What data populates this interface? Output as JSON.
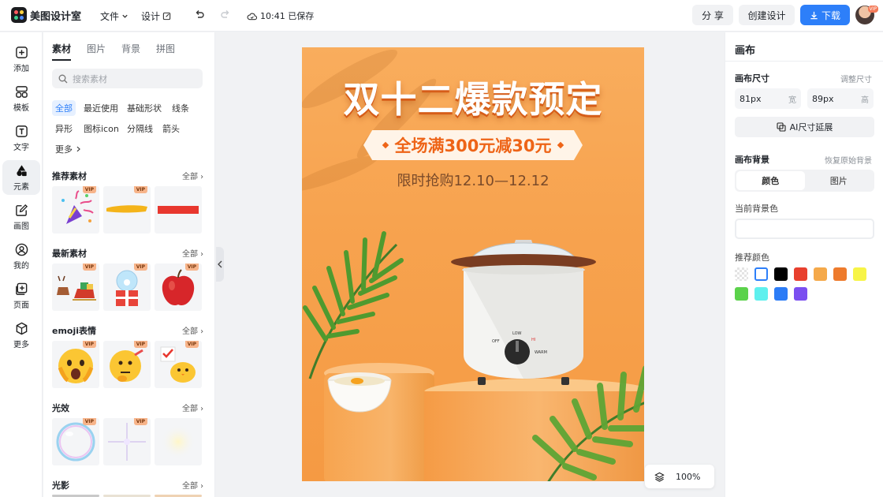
{
  "topbar": {
    "brand": "美图设计室",
    "file_menu": "文件",
    "design_menu": "设计",
    "saved_status": "10:41 已保存",
    "share_label": "分 享",
    "create_label": "创建设计",
    "download_label": "下载",
    "avatar_badge": "VIP"
  },
  "leftnav": {
    "items": [
      {
        "label": "添加",
        "icon": "plus-square-icon"
      },
      {
        "label": "模板",
        "icon": "template-grid-icon"
      },
      {
        "label": "文字",
        "icon": "text-t-icon"
      },
      {
        "label": "元素",
        "icon": "shapes-icon"
      },
      {
        "label": "画图",
        "icon": "edit-pencil-icon"
      },
      {
        "label": "我的",
        "icon": "user-icon"
      },
      {
        "label": "页面",
        "icon": "add-page-icon"
      },
      {
        "label": "更多",
        "icon": "cube-icon"
      }
    ],
    "active": "元素"
  },
  "panel": {
    "tabs": [
      "素材",
      "图片",
      "背景",
      "拼图"
    ],
    "active_tab": "素材",
    "search_placeholder": "搜索素材",
    "chips": [
      "全部",
      "最近使用",
      "基础形状",
      "线条",
      "异形",
      "图标icon",
      "分隔线",
      "箭头",
      "更多"
    ],
    "active_chip": "全部",
    "all_label": "全部",
    "vip_badge": "VIP",
    "sections": [
      {
        "title": "推荐素材"
      },
      {
        "title": "最新素材"
      },
      {
        "title": "emoji表情"
      },
      {
        "title": "光效"
      },
      {
        "title": "光影"
      }
    ]
  },
  "poster": {
    "title": "双十二爆款预定",
    "ribbon": "全场满300元减30元",
    "subtitle": "限时抢购12.10—12.12",
    "dial_labels": [
      "OFF",
      "LOW",
      "HI",
      "WARM"
    ]
  },
  "zoom": {
    "level": "100%"
  },
  "right_panel": {
    "title": "画布",
    "canvas_size_label": "画布尺寸",
    "adjust_size_link": "调整尺寸",
    "width_value": "81px",
    "width_unit": "宽",
    "height_value": "89px",
    "height_unit": "高",
    "ai_extend_label": "AI尺寸延展",
    "canvas_bg_label": "画布背景",
    "restore_bg_link": "恢复原始背景",
    "seg_color": "颜色",
    "seg_image": "图片",
    "current_bg_label": "当前背景色",
    "recommended_colors_label": "推荐颜色",
    "colors": [
      "transparent",
      "#ffffff",
      "#000000",
      "#e8402e",
      "#f5a94a",
      "#ee7b2d",
      "#f7f447",
      "#5bd24b",
      "#5ef0ee",
      "#2c7cf6",
      "#7b4ff0"
    ]
  }
}
